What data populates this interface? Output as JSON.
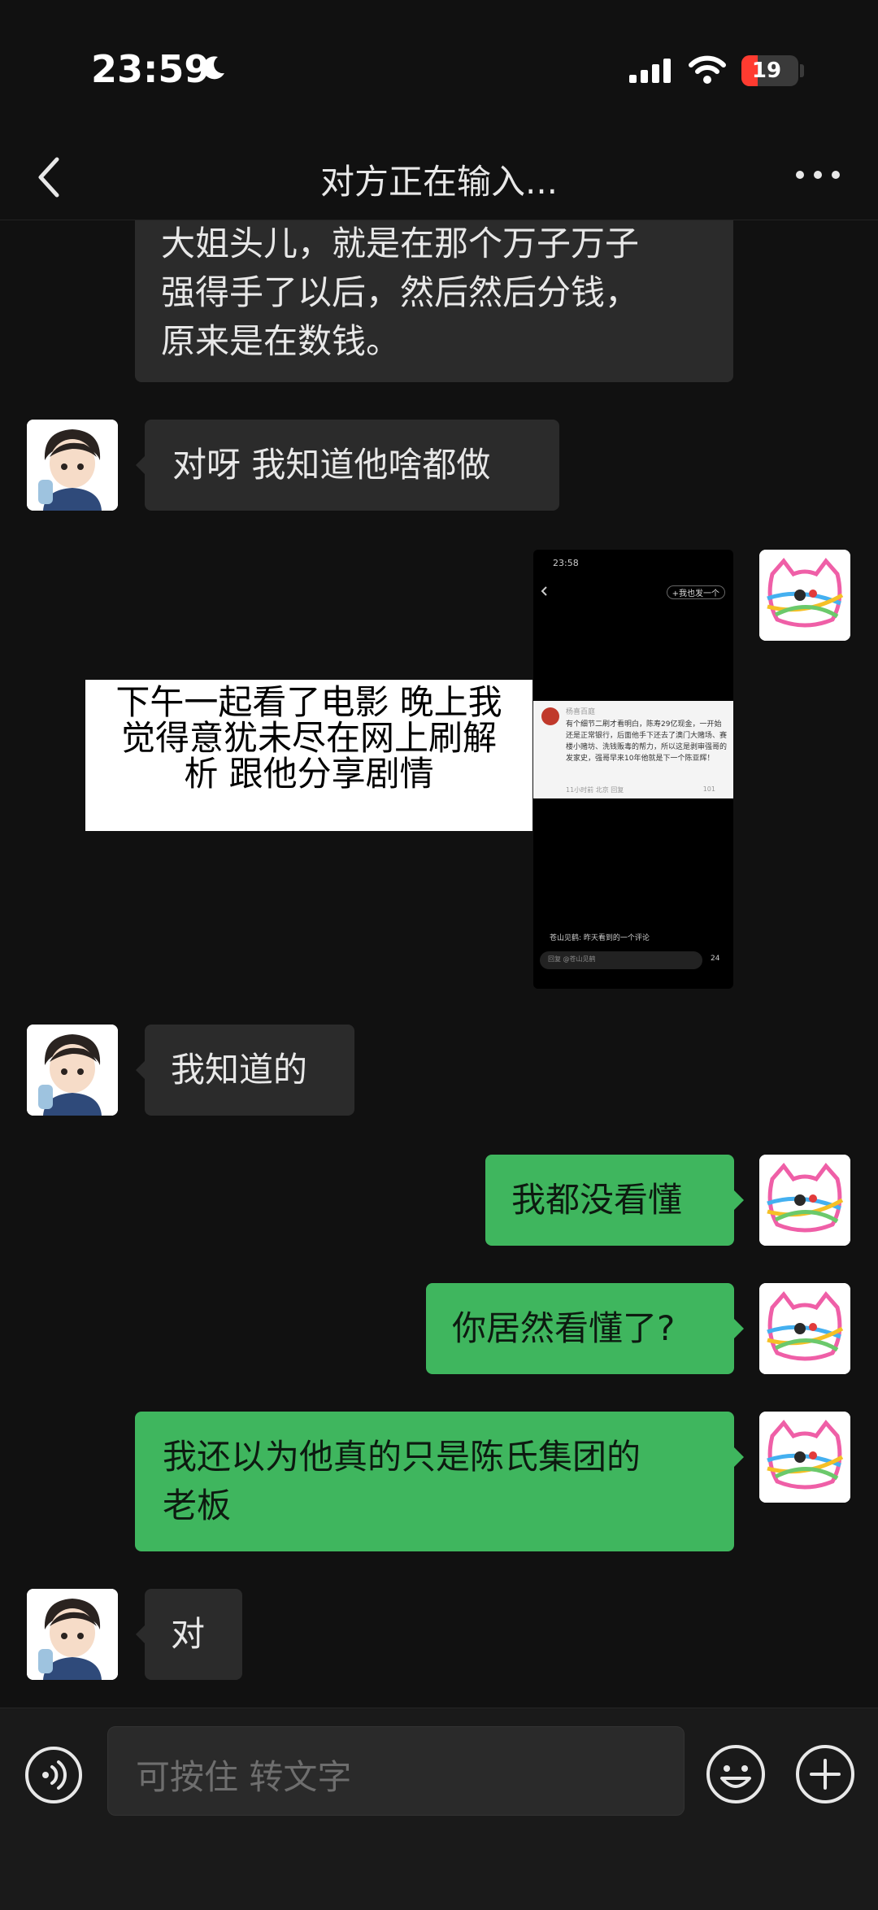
{
  "status_bar": {
    "time": "23:59",
    "battery": "19"
  },
  "header": {
    "title": "对方正在输入..."
  },
  "messages": {
    "m1_line1": "大姐头儿，就是在那个万子万子",
    "m1_line2": "强得手了以后，然后然后分钱，",
    "m1_line3": "原来是在数钱。",
    "m2": "对呀 我知道他啥都做",
    "caption_line1": "下午一起看了电影 晚上我",
    "caption_line2": "觉得意犹未尽在网上刷解",
    "caption_line3": "析 跟他分享剧情",
    "m4": "我知道的",
    "m5": "我都没看懂",
    "m6": "你居然看懂了?",
    "m7_line1": "我还以为他真的只是陈氏集团的",
    "m7_line2": "老板",
    "m8": "对"
  },
  "shared_screenshot": {
    "time": "23:58",
    "top_button": "+我也发一个",
    "card_author": "杨喜百庭",
    "card_text": "有个细节二刷才看明白，陈寿29亿现金，一开始还是正常银行，后面他手下还去了澳门大赌场、赛楼小赌坊、洗钱贩毒的帮力，所以这是剥审强哥的发家史，强哥早来10年他就是下一个陈亚辉！",
    "card_meta": "11小时前 北京  回复",
    "card_likes": "101",
    "bottom_comment": "苍山见鹤: 昨天看到的一个评论",
    "input_hint": "回复 @苍山见鹤",
    "bottom_likes": "24"
  },
  "input": {
    "placeholder": "可按住 转文字"
  },
  "icons": {
    "back": "chevron-left-icon",
    "more": "more-dots-icon",
    "voice": "voice-icon",
    "emoji": "emoji-icon",
    "plus": "plus-icon"
  },
  "colors": {
    "bg": "#111111",
    "bubble_left": "#2b2b2b",
    "bubble_right": "#3fb65e",
    "battery_low": "#ff3b30"
  }
}
